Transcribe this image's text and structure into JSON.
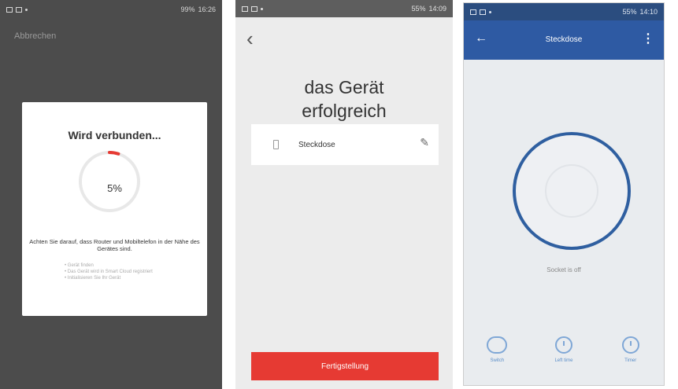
{
  "screen1": {
    "status_time": "16:26",
    "status_battery": "99%",
    "cancel_label": "Abbrechen",
    "dialog_title": "Wird verbunden...",
    "progress": 0.05,
    "progress_text": "5%",
    "message": "Achten Sie darauf, dass Router und Mobiltelefon in der Nähe des Gerätes sind.",
    "steps": [
      "Gerät finden",
      "Das Gerät wird in Smart Cloud registriert",
      "Initialisieren Sie Ihr Gerät"
    ],
    "accent_color": "#e63a33"
  },
  "screen2": {
    "status_time": "14:09",
    "status_battery": "55%",
    "heading_line1": "das Gerät",
    "heading_line2": "erfolgreich",
    "device_name": "Steckdose",
    "finish_label": "Fertigstellung",
    "button_color": "#e63a33"
  },
  "screen3": {
    "status_time": "14:10",
    "status_battery": "55%",
    "title": "Steckdose",
    "state_text": "Socket is off",
    "bottom": [
      {
        "label": "Switch",
        "icon": "switch-icon"
      },
      {
        "label": "Left time",
        "icon": "timer-icon"
      },
      {
        "label": "Timer",
        "icon": "clock-icon"
      }
    ],
    "appbar_color": "#2e5aa3"
  }
}
